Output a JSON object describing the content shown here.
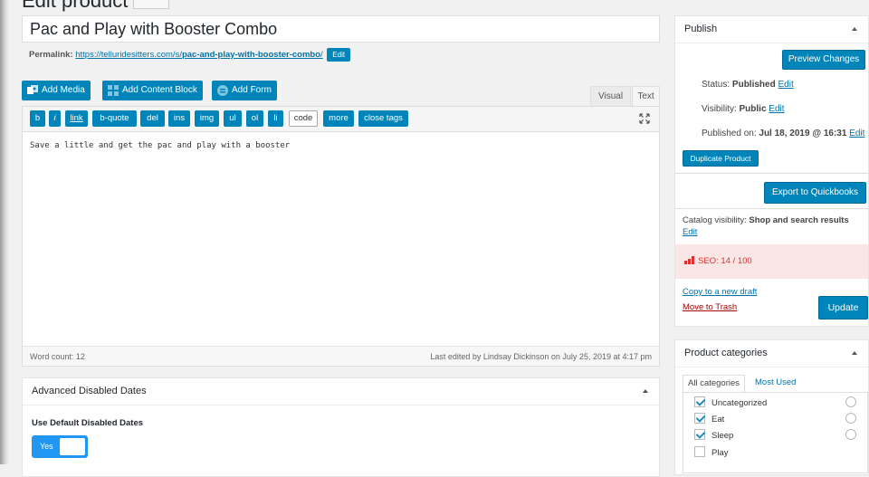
{
  "page": {
    "heading": "Edit product"
  },
  "post": {
    "title": "Pac and Play with Booster Combo",
    "permalink_label": "Permalink:",
    "permalink_base": "https://telluridesitters.com/s/",
    "permalink_slug": "pac-and-play-with-booster-combo",
    "permalink_trailing": "/",
    "edit_label": "Edit"
  },
  "media_buttons": {
    "add_media": "Add Media",
    "add_content_block": "Add Content Block",
    "add_form": "Add Form"
  },
  "editor_tabs": {
    "visual": "Visual",
    "text": "Text"
  },
  "quicktags": [
    "b",
    "i",
    "link",
    "b-quote",
    "del",
    "ins",
    "img",
    "ul",
    "ol",
    "li",
    "code",
    "more",
    "close tags"
  ],
  "editor": {
    "content": "Save a little and get the pac and play with a booster",
    "word_count": "Word count: 12",
    "last_edited": "Last edited by Lindsay Dickinson on July 25, 2019 at 4:17 pm"
  },
  "advanced_dates": {
    "title": "Advanced Disabled Dates",
    "use_default_label": "Use Default Disabled Dates",
    "toggle_label": "Yes",
    "toggle_on": true
  },
  "publish": {
    "title": "Publish",
    "preview_button": "Preview Changes",
    "status_label": "Status:",
    "status_value": "Published",
    "visibility_label": "Visibility:",
    "visibility_value": "Public",
    "published_label": "Published on:",
    "published_value": "Jul 18, 2019 @ 16:31",
    "edit_link": "Edit",
    "duplicate_button": "Duplicate Product",
    "export_button": "Export to Quickbooks",
    "catalog_label": "Catalog visibility:",
    "catalog_value": "Shop and search results",
    "seo_text": "SEO: 14 / 100",
    "copy_draft": "Copy to a new draft",
    "trash": "Move to Trash",
    "update_button": "Update"
  },
  "categories": {
    "title": "Product categories",
    "tab_all": "All categories",
    "tab_used": "Most Used",
    "items": [
      {
        "label": "Uncategorized",
        "checked": true
      },
      {
        "label": "Eat",
        "checked": true
      },
      {
        "label": "Sleep",
        "checked": true
      },
      {
        "label": "Play",
        "checked": false
      }
    ]
  },
  "colors": {
    "primary": "#0085ba",
    "link": "#0073aa",
    "seo_bad": "#dc3232",
    "toggle": "#2196f3"
  }
}
